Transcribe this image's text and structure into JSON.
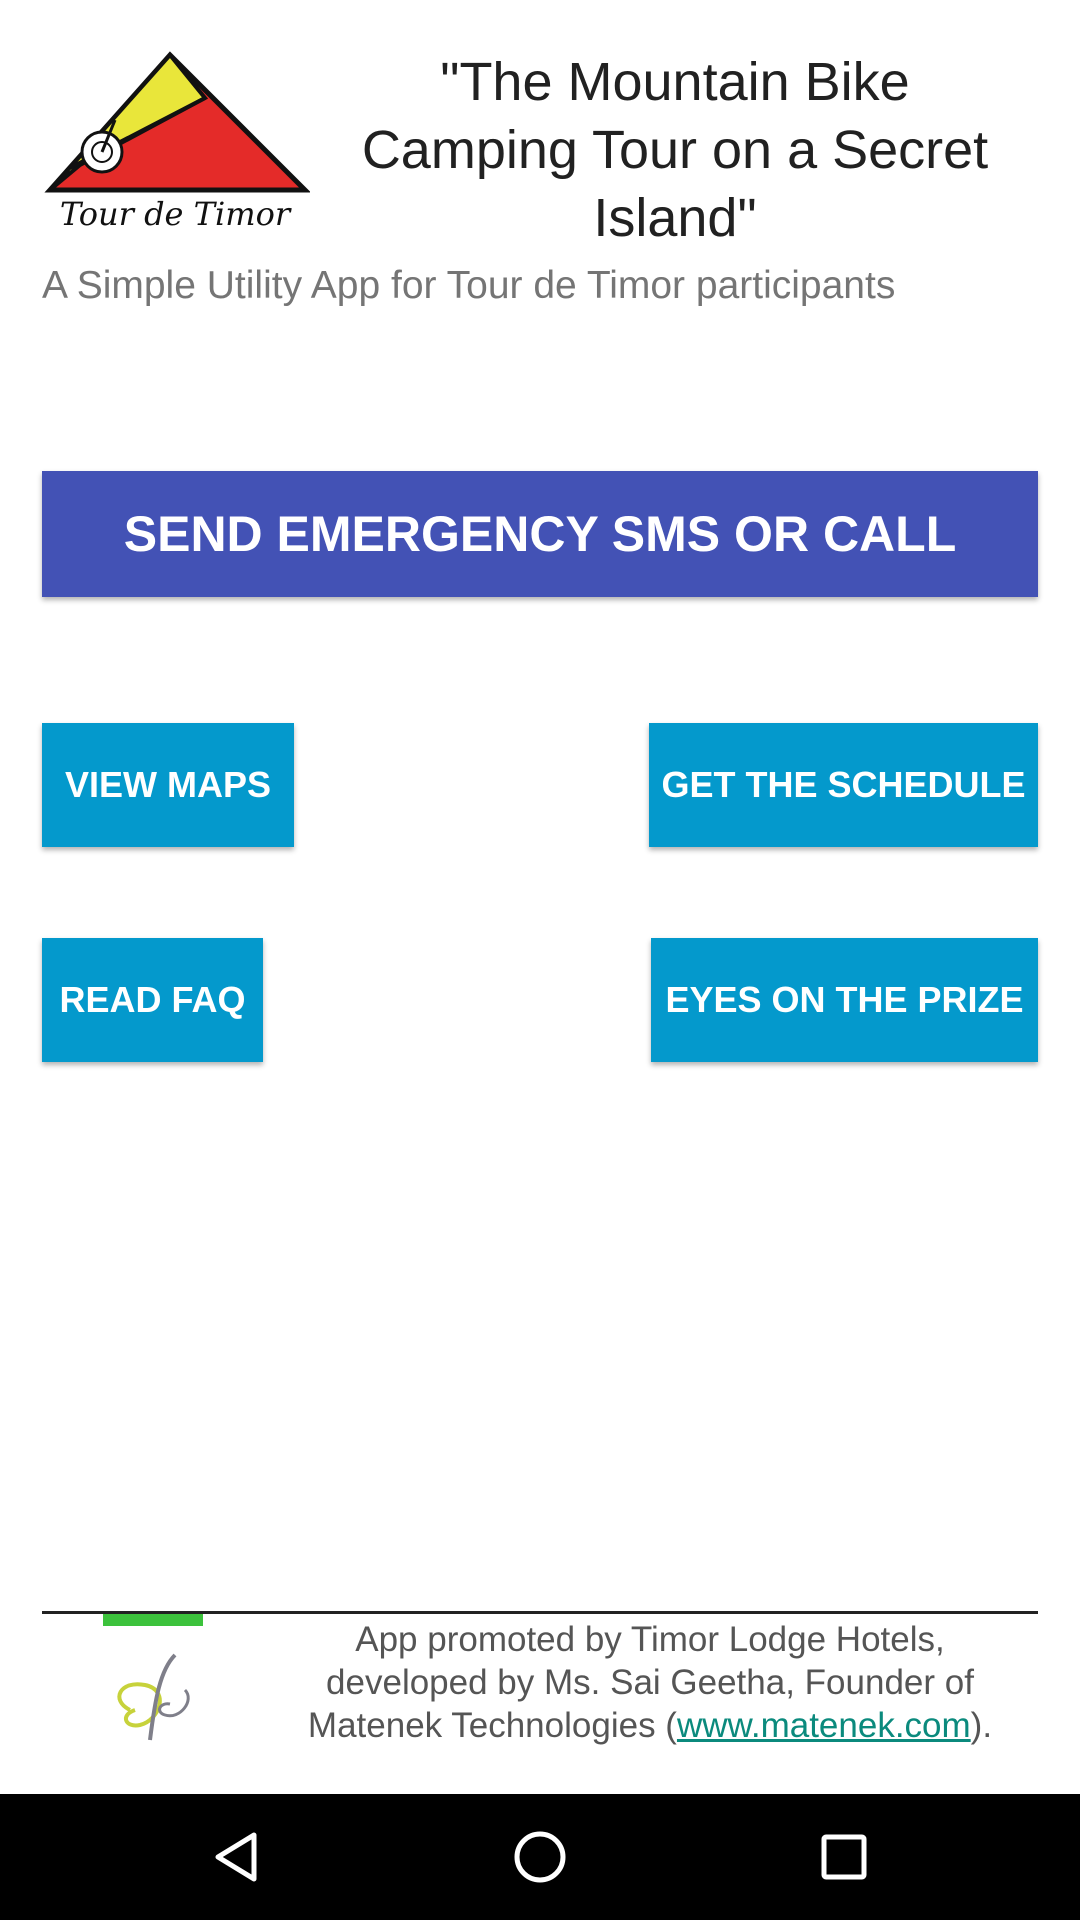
{
  "header": {
    "title": "\"The Mountain Bike Camping Tour on a Secret Island\"",
    "subtitle": "A Simple Utility App for Tour de Timor participants",
    "logo_text": "Tour de Timor"
  },
  "buttons": {
    "emergency": "SEND EMERGENCY SMS OR CALL",
    "view_maps": "VIEW MAPS",
    "get_schedule": "GET THE SCHEDULE",
    "read_faq": "READ FAQ",
    "eyes_on_prize": "EYES ON THE PRIZE"
  },
  "footer": {
    "text_before": "App promoted by Timor Lodge Hotels, developed by Ms. Sai Geetha, Founder of Matenek Technologies (",
    "link": "www.matenek.com",
    "text_after": ")."
  },
  "colors": {
    "primary_button": "#4352b5",
    "secondary_button": "#0499cc",
    "link": "#0b8a7d",
    "accent_bar": "#3cc23c"
  },
  "navbar": {
    "icons": [
      "back-icon",
      "home-icon",
      "recents-icon"
    ]
  }
}
